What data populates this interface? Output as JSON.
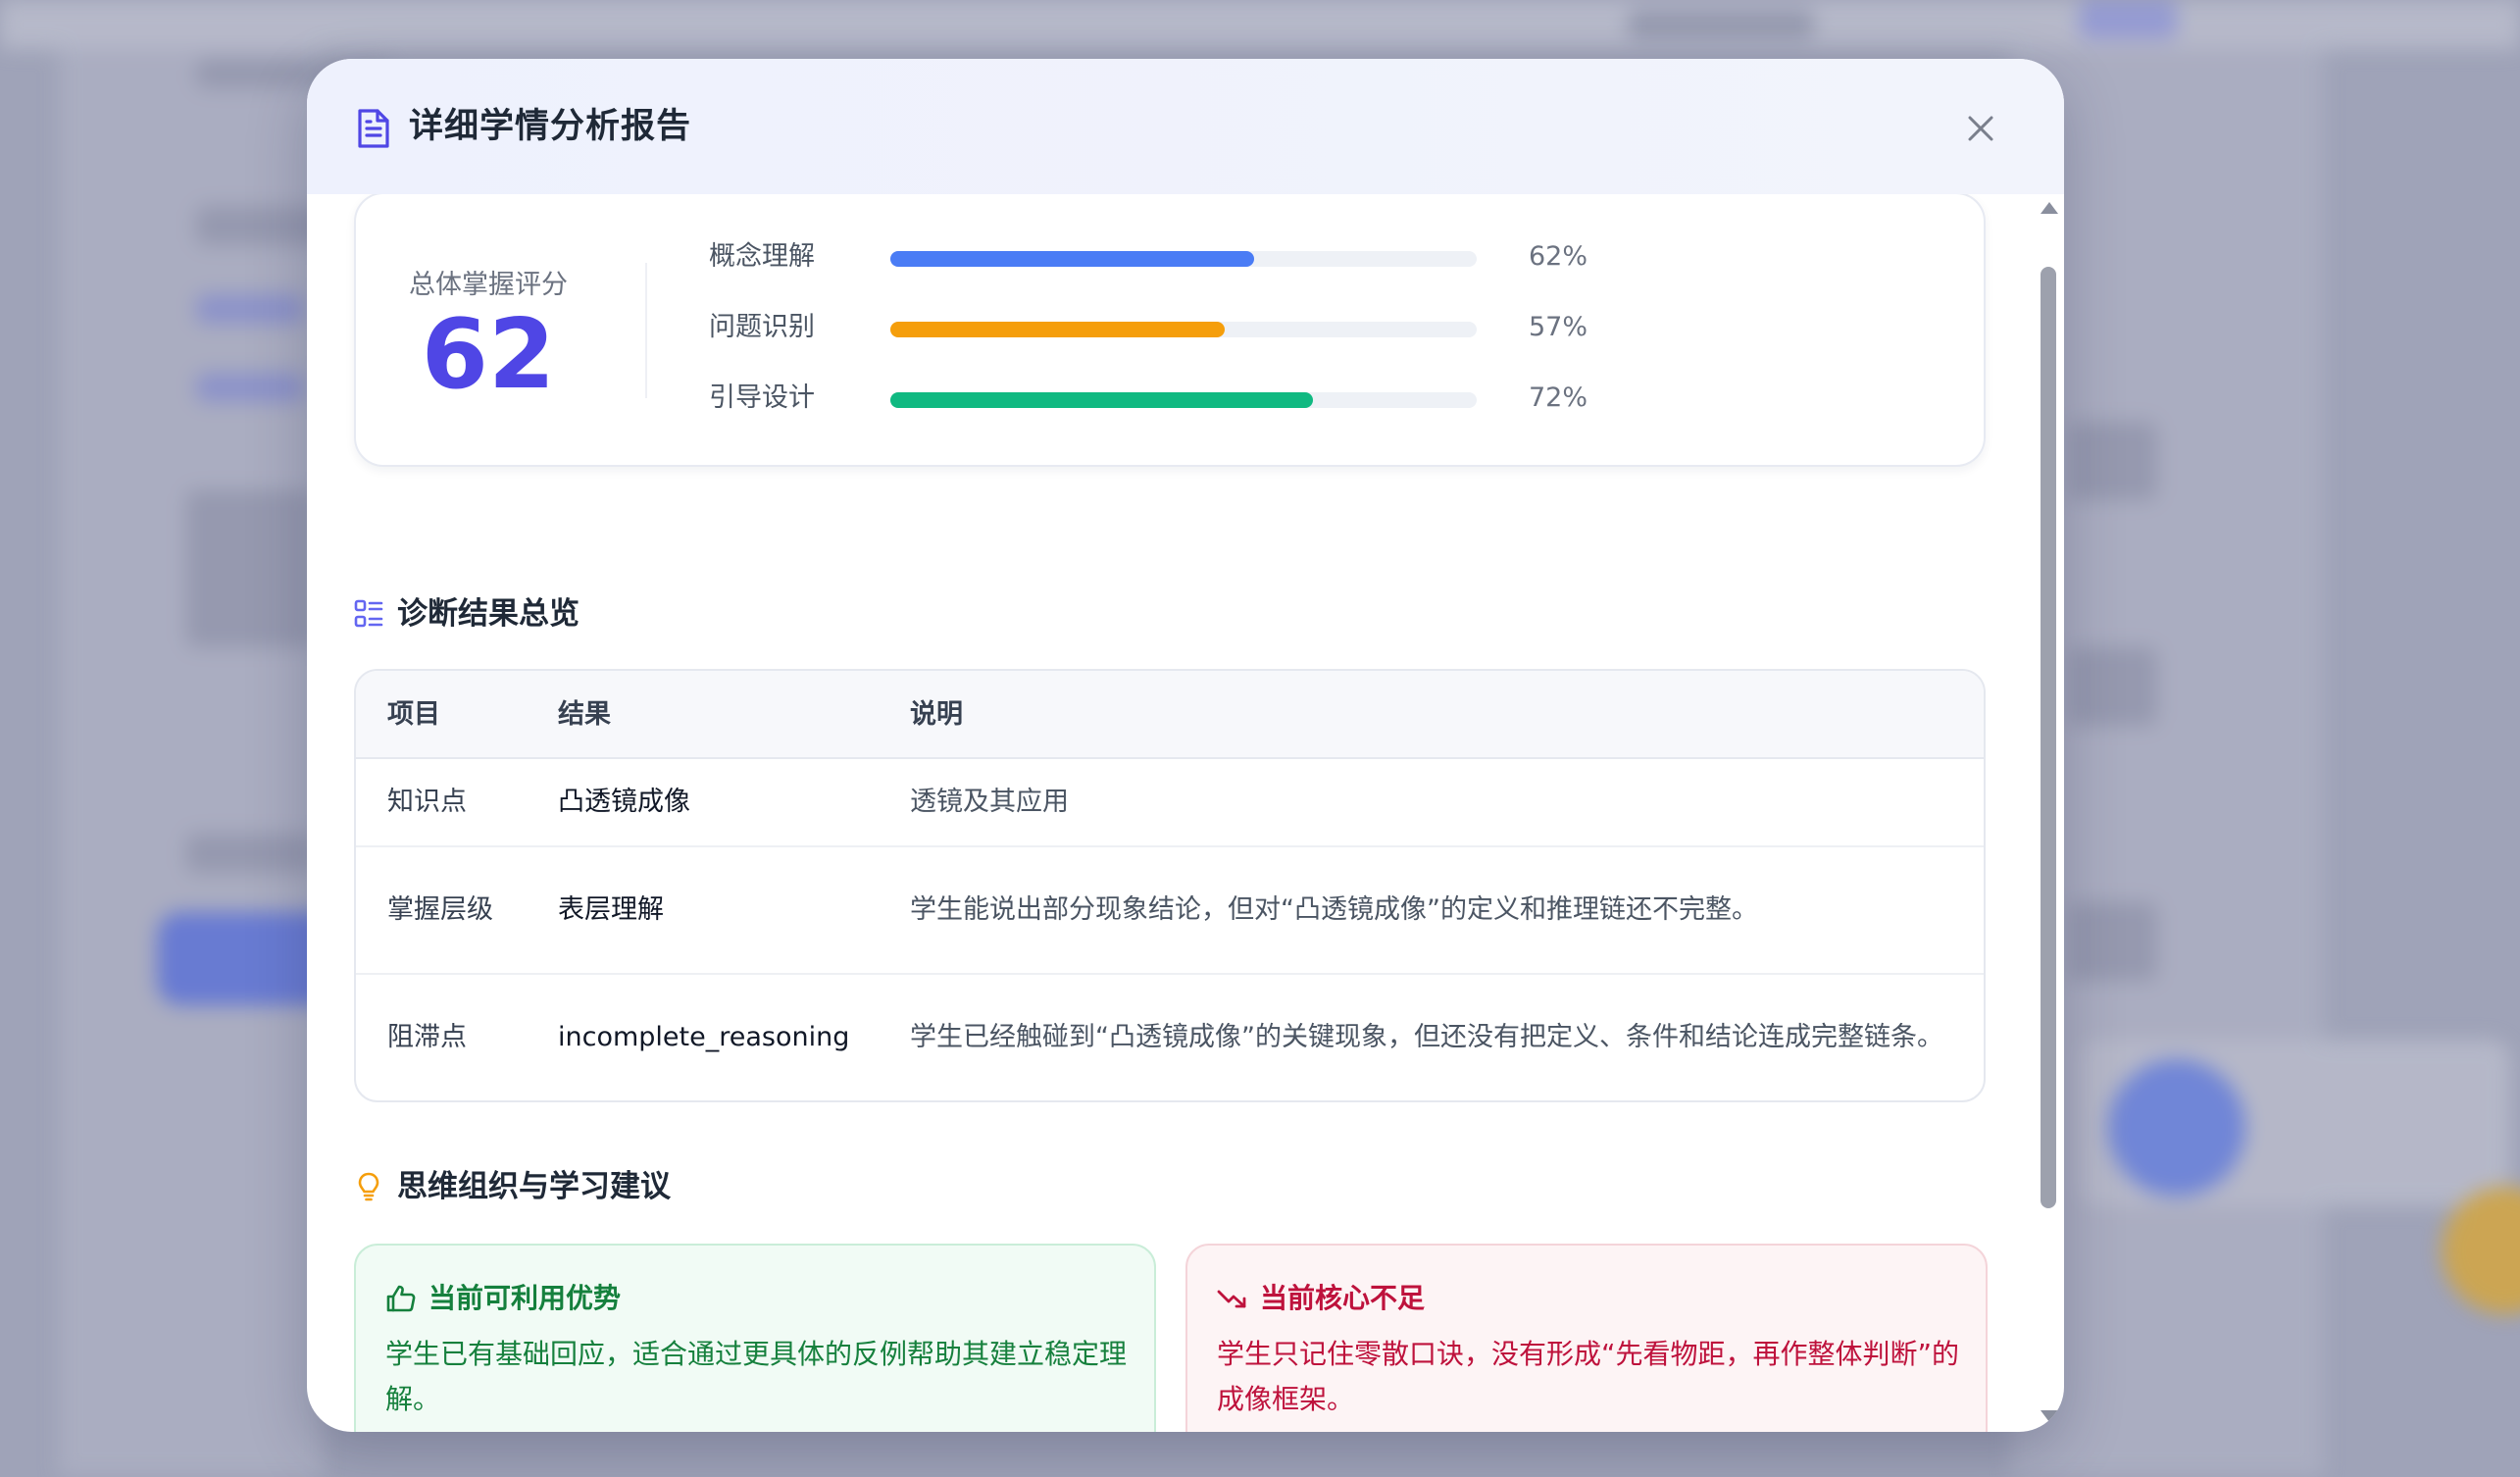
{
  "modal": {
    "title": "详细学情分析报告",
    "close_label": "×"
  },
  "score": {
    "label": "总体掌握评分",
    "value": "62",
    "metrics": [
      {
        "label": "概念理解",
        "percent": 62,
        "percent_text": "62%",
        "color": "#4a7cf5"
      },
      {
        "label": "问题识别",
        "percent": 57,
        "percent_text": "57%",
        "color": "#f59e0b"
      },
      {
        "label": "引导设计",
        "percent": 72,
        "percent_text": "72%",
        "color": "#10b981"
      }
    ]
  },
  "diagnosis": {
    "title": "诊断结果总览",
    "headers": [
      "项目",
      "结果",
      "说明"
    ],
    "rows": [
      {
        "item": "知识点",
        "result": "凸透镜成像",
        "desc": "透镜及其应用"
      },
      {
        "item": "掌握层级",
        "result": "表层理解",
        "desc": "学生能说出部分现象结论，但对“凸透镜成像”的定义和推理链还不完整。"
      },
      {
        "item": "阻滞点",
        "result": "incomplete_reasoning",
        "desc": "学生已经触碰到“凸透镜成像”的关键现象，但还没有把定义、条件和结论连成完整链条。"
      }
    ]
  },
  "advice": {
    "title": "思维组织与学习建议",
    "strength": {
      "title": "当前可利用优势",
      "text": "学生已有基础回应，适合通过更具体的反例帮助其建立稳定理解。"
    },
    "weakness": {
      "title": "当前核心不足",
      "text": "学生只记住零散口诀，没有形成“先看物距，再作整体判断”的成像框架。"
    }
  },
  "colors": {
    "accent": "#4f46e5",
    "good": "#15803d",
    "bad": "#be123c",
    "advice_icon": "#f59e0b"
  }
}
